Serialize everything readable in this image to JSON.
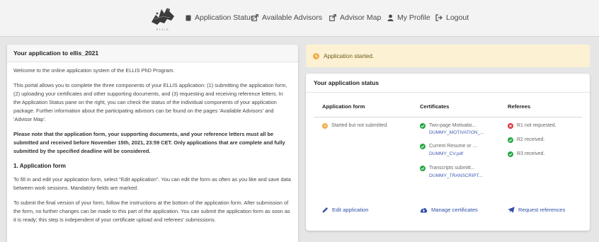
{
  "nav": {
    "logo_text": "ELLIS",
    "links": [
      {
        "label": "Application Status",
        "icon": "file-icon"
      },
      {
        "label": "Available Advisors",
        "icon": "external-link-icon"
      },
      {
        "label": "Advisor Map",
        "icon": "external-link-icon"
      },
      {
        "label": "My Profile",
        "icon": "user-icon"
      },
      {
        "label": "Logout",
        "icon": "logout-icon"
      }
    ]
  },
  "info": {
    "title": "Your application to ellis_2021",
    "welcome": "Welcome to the online application system of the ELLIS PhD Program.",
    "intro": "This portal allows you to complete the three components of your ELLIS application: (1) submitting the application form, (2) uploading your certificates and other supporting documents, and (3) requesting and receiving reference letters. In the Application Status pane on the right, you can check the status of the individual components of your application package. Further information about the participating advisors can be found on the pages 'Available Advisors' and 'Advisor Map'.",
    "deadline": "Please note that the application form, your supporting documents, and your reference letters must all be submitted and received before November 15th, 2021, 23:59 CET. Only applications that are complete and fully submitted by the specified deadline will be considered.",
    "section_heading": "1. Application form",
    "section_p1": "To fill in and edit your application form, select \"Edit application\". You can edit the form as often as you like and save data between work sessions. Mandatory fields are marked.",
    "section_p2": "To submit the final version of your form, follow the instructions at the bottom of the application form. After submission of the form, no further changes can be made to this part of the application. You can submit the application form as soon as it is ready; this step is independent of your certificate upload and referees' submissions."
  },
  "alert": {
    "text": "Application started."
  },
  "status": {
    "title": "Your application status",
    "columns": {
      "form": "Application form",
      "certificates": "Certificates",
      "referees": "Referees"
    },
    "form_status": "Started but not submitted.",
    "certificates": [
      {
        "label": "Two-page Motivatio...",
        "file": "DUMMY_MOTIVATION_..."
      },
      {
        "label": "Current Resume or ...",
        "file": "DUMMY_CV.pdf"
      },
      {
        "label": "Transcripts submitt...",
        "file": "DUMMY_TRANSCRIPT..."
      }
    ],
    "referees": [
      {
        "label": "R1 not requested.",
        "state": "error"
      },
      {
        "label": "R2 received.",
        "state": "ok"
      },
      {
        "label": "R3 received.",
        "state": "ok"
      }
    ],
    "actions": {
      "edit": "Edit application",
      "manage": "Manage certificates",
      "request": "Request references"
    }
  },
  "colors": {
    "success": "#28a745",
    "warning": "#f0ad4e",
    "danger": "#dc3545",
    "link": "#2f4fa8",
    "alert_bg": "#fcf1d3"
  }
}
